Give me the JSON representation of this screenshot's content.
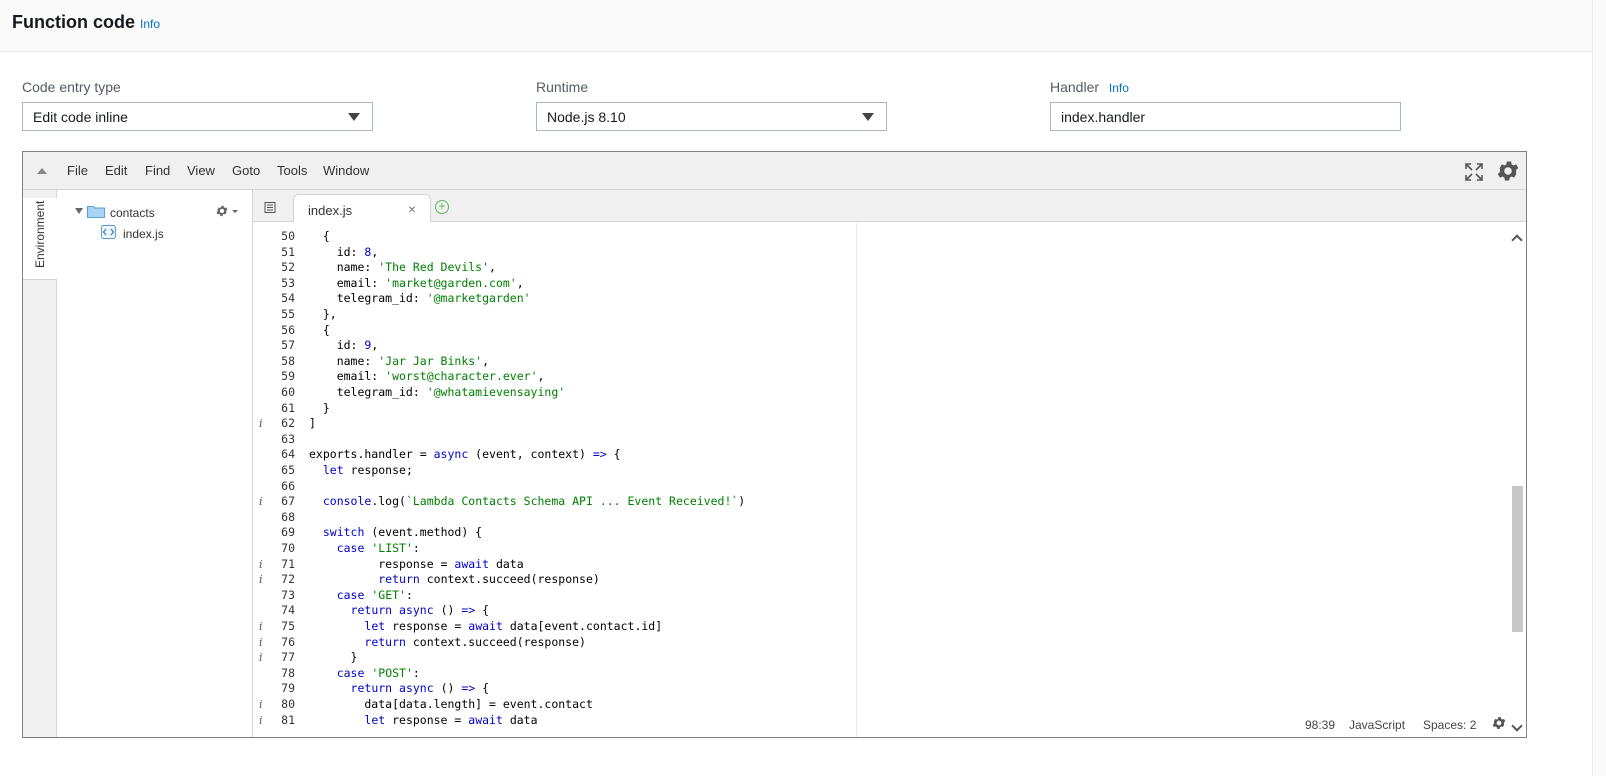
{
  "header": {
    "title": "Function code",
    "info": "Info"
  },
  "fields": {
    "code_entry_type": {
      "label": "Code entry type",
      "value": "Edit code inline"
    },
    "runtime": {
      "label": "Runtime",
      "value": "Node.js 8.10"
    },
    "handler": {
      "label": "Handler",
      "info": "Info",
      "value": "index.handler"
    }
  },
  "ide": {
    "menu": [
      "File",
      "Edit",
      "Find",
      "View",
      "Goto",
      "Tools",
      "Window"
    ],
    "environment_tab": "Environment",
    "tree": {
      "folder": "contacts",
      "file": "index.js"
    },
    "tab": {
      "label": "index.js",
      "close": "×",
      "add": "+"
    },
    "status": {
      "cursor": "98:39",
      "language": "JavaScript",
      "indent": "Spaces: 2"
    }
  },
  "code_lines": [
    {
      "n": "50",
      "ann": "",
      "text": "  {"
    },
    {
      "n": "51",
      "ann": "",
      "text": "    id: 8,"
    },
    {
      "n": "52",
      "ann": "",
      "text": "    name: 'The Red Devils',"
    },
    {
      "n": "53",
      "ann": "",
      "text": "    email: 'market@garden.com',"
    },
    {
      "n": "54",
      "ann": "",
      "text": "    telegram_id: '@marketgarden'"
    },
    {
      "n": "55",
      "ann": "",
      "text": "  },"
    },
    {
      "n": "56",
      "ann": "",
      "text": "  {"
    },
    {
      "n": "57",
      "ann": "",
      "text": "    id: 9,"
    },
    {
      "n": "58",
      "ann": "",
      "text": "    name: 'Jar Jar Binks',"
    },
    {
      "n": "59",
      "ann": "",
      "text": "    email: 'worst@character.ever',"
    },
    {
      "n": "60",
      "ann": "",
      "text": "    telegram_id: '@whatamievensaying'"
    },
    {
      "n": "61",
      "ann": "",
      "text": "  }"
    },
    {
      "n": "62",
      "ann": "i",
      "text": "]"
    },
    {
      "n": "63",
      "ann": "",
      "text": ""
    },
    {
      "n": "64",
      "ann": "",
      "text": "exports.handler = async (event, context) => {"
    },
    {
      "n": "65",
      "ann": "",
      "text": "  let response;"
    },
    {
      "n": "66",
      "ann": "",
      "text": ""
    },
    {
      "n": "67",
      "ann": "i",
      "text": "  console.log(`Lambda Contacts Schema API ... Event Received!`)"
    },
    {
      "n": "68",
      "ann": "",
      "text": ""
    },
    {
      "n": "69",
      "ann": "",
      "text": "  switch (event.method) {"
    },
    {
      "n": "70",
      "ann": "",
      "text": "    case 'LIST':"
    },
    {
      "n": "71",
      "ann": "i",
      "text": "          response = await data"
    },
    {
      "n": "72",
      "ann": "i",
      "text": "          return context.succeed(response)"
    },
    {
      "n": "73",
      "ann": "",
      "text": "    case 'GET':"
    },
    {
      "n": "74",
      "ann": "",
      "text": "      return async () => {"
    },
    {
      "n": "75",
      "ann": "i",
      "text": "        let response = await data[event.contact.id]"
    },
    {
      "n": "76",
      "ann": "i",
      "text": "        return context.succeed(response)"
    },
    {
      "n": "77",
      "ann": "i",
      "text": "      }"
    },
    {
      "n": "78",
      "ann": "",
      "text": "    case 'POST':"
    },
    {
      "n": "79",
      "ann": "",
      "text": "      return async () => {"
    },
    {
      "n": "80",
      "ann": "i",
      "text": "        data[data.length] = event.contact"
    },
    {
      "n": "81",
      "ann": "i",
      "text": "        let response = await data"
    }
  ],
  "colors": {
    "accent_link": "#0073bb",
    "keyword": "#0000cd",
    "string": "#008000",
    "add_tab": "#5cb85c"
  },
  "icons": [
    "folder-icon",
    "file-icon",
    "gear-icon",
    "fullscreen-icon",
    "tab-list-icon",
    "close-icon",
    "plus-circle-icon",
    "chevron-up-icon",
    "chevron-down-icon"
  ]
}
